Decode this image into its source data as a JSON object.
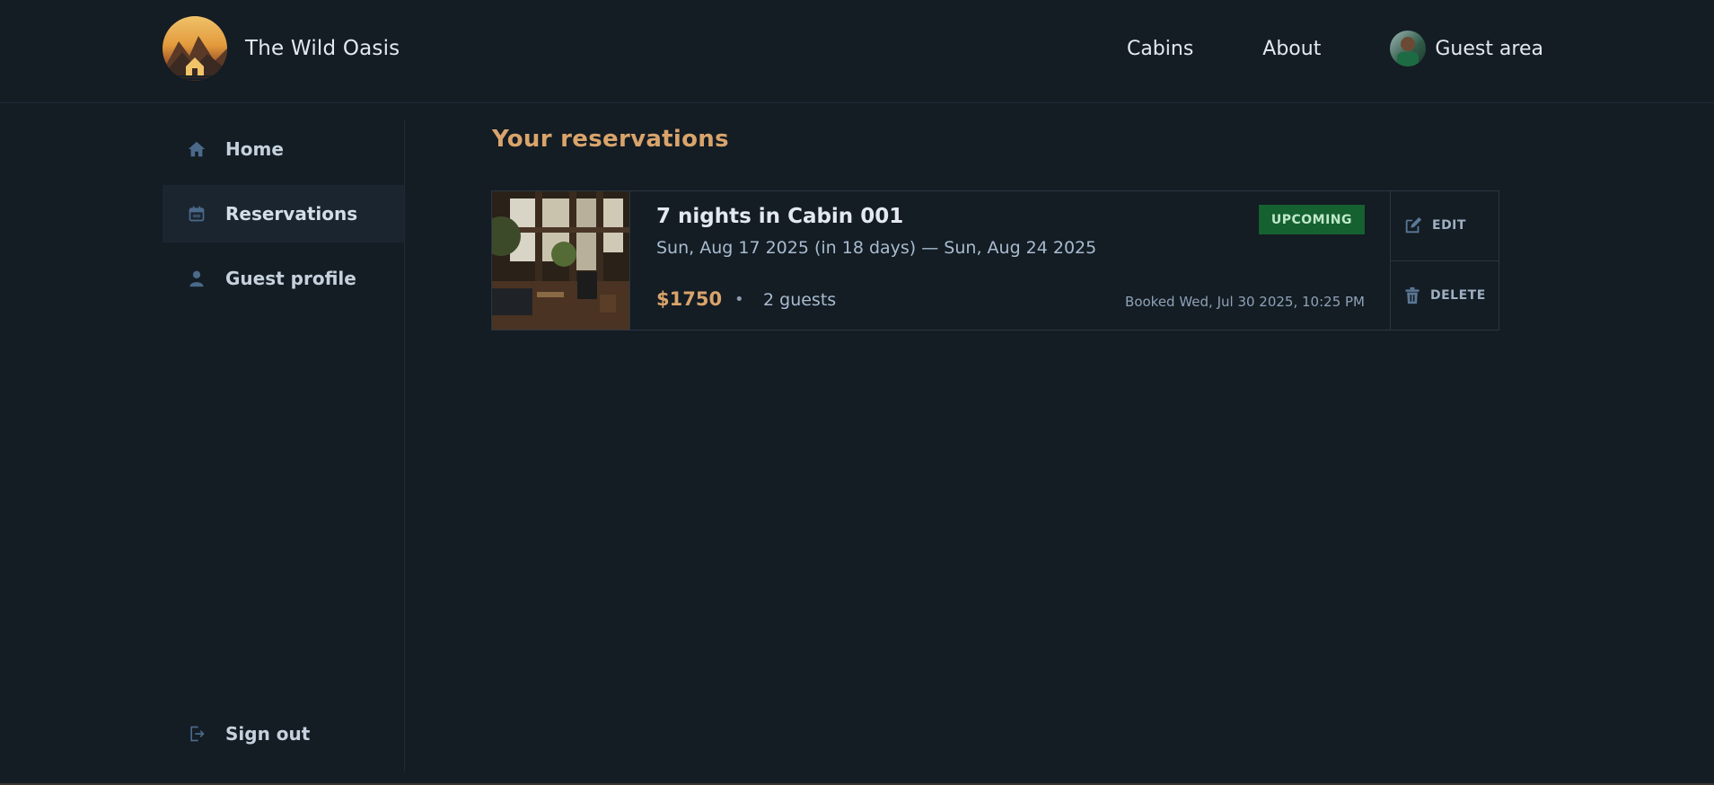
{
  "header": {
    "brand": "The Wild Oasis",
    "nav": [
      {
        "label": "Cabins"
      },
      {
        "label": "About"
      },
      {
        "label": "Guest area"
      }
    ]
  },
  "sidebar": {
    "items": [
      {
        "label": "Home",
        "icon": "home-icon"
      },
      {
        "label": "Reservations",
        "icon": "calendar-icon",
        "active": true
      },
      {
        "label": "Guest profile",
        "icon": "user-icon"
      }
    ],
    "signout": {
      "label": "Sign out",
      "icon": "sign-out-icon"
    }
  },
  "main": {
    "title": "Your reservations",
    "reservations": [
      {
        "name": "7 nights in Cabin 001",
        "dates": "Sun, Aug 17 2025 (in 18 days) — Sun, Aug 24 2025",
        "price": "$1750",
        "separator": "•",
        "guests": "2 guests",
        "status": "UPCOMING",
        "booked": "Booked Wed, Jul 30 2025, 10:25 PM",
        "edit_label": "EDIT",
        "delete_label": "DELETE"
      }
    ]
  },
  "colors": {
    "background": "#141c24",
    "accent": "#d9a46b",
    "badge_bg": "#15612f",
    "badge_text": "#bfe8cb"
  }
}
